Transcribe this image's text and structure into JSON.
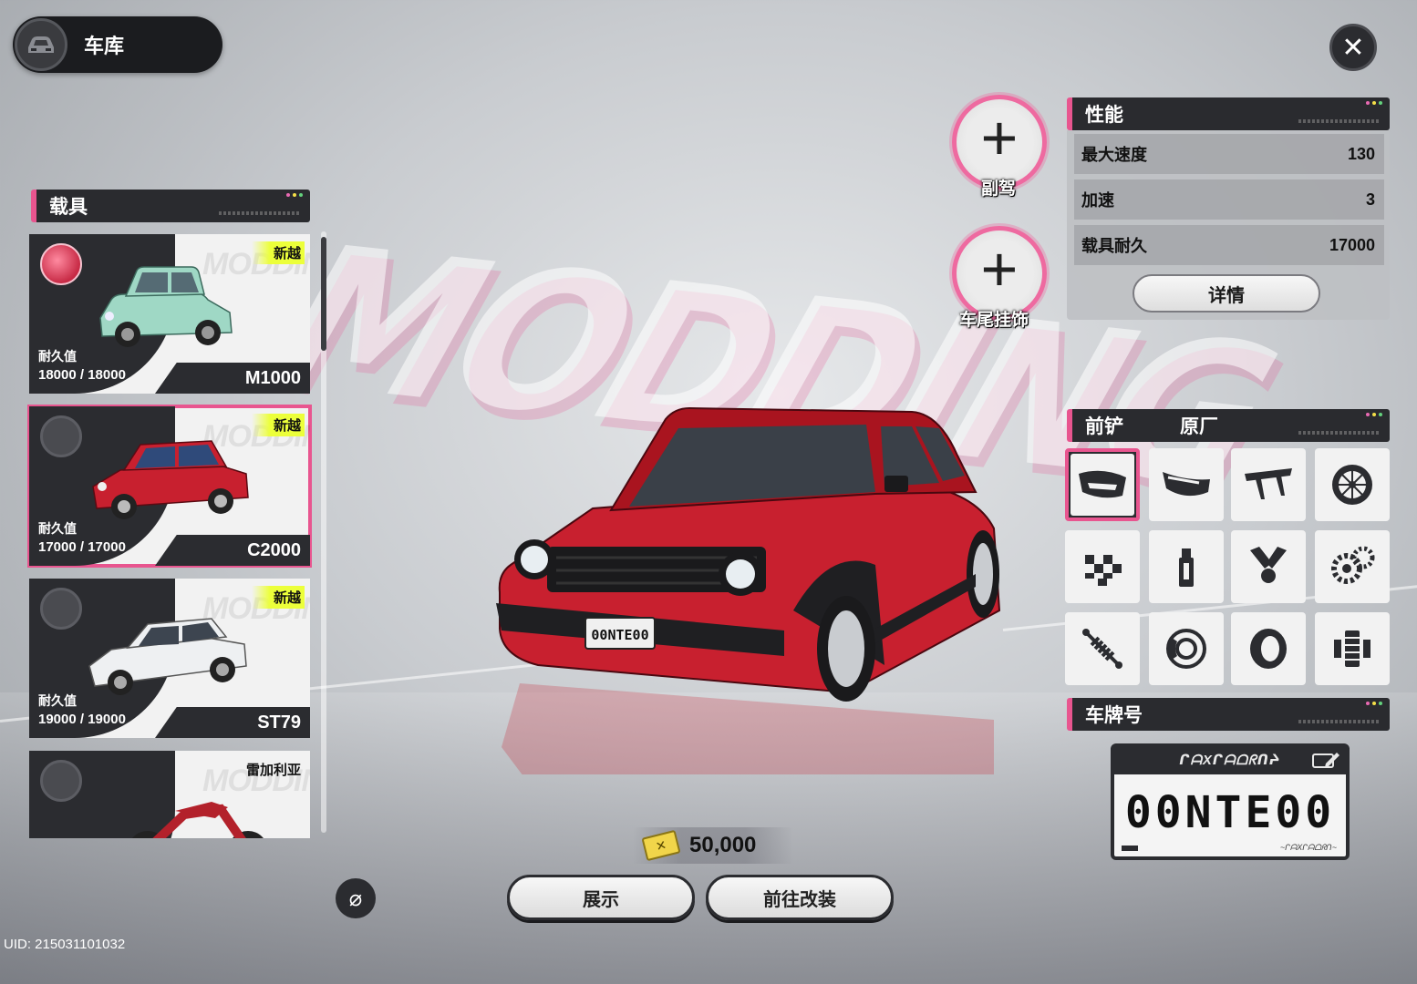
{
  "garage": {
    "title": "车库"
  },
  "background": {
    "word": "MODDING"
  },
  "vehicle_section": {
    "title": "载具"
  },
  "vehicles": [
    {
      "brand": "新越",
      "durability_label": "耐久值",
      "durability": "18000 / 18000",
      "model": "M1000",
      "color": "#9fd8c5"
    },
    {
      "brand": "新越",
      "durability_label": "耐久值",
      "durability": "17000 / 17000",
      "model": "C2000",
      "color": "#c8202f"
    },
    {
      "brand": "新越",
      "durability_label": "耐久值",
      "durability": "19000 / 19000",
      "model": "ST79",
      "color": "#eef0f2"
    },
    {
      "brand": "雷加利亚",
      "model": "",
      "color": "#b3212b"
    }
  ],
  "currency": {
    "amount": "50,000"
  },
  "buttons": {
    "display": "展示",
    "modify": "前往改装"
  },
  "uid": "UID: 215031101032",
  "add_slots": {
    "copilot": "副驾",
    "rear_ornament": "车尾挂饰"
  },
  "performance": {
    "title": "性能",
    "rows": [
      {
        "label": "最大速度",
        "value": "130"
      },
      {
        "label": "加速",
        "value": "3"
      },
      {
        "label": "载具耐久",
        "value": "17000"
      }
    ],
    "details_label": "详情"
  },
  "parts": {
    "category": "前铲",
    "current": "原厂",
    "icons": [
      "front-bumper-icon",
      "rear-bumper-icon",
      "spoiler-icon",
      "rim-icon",
      "livery-icon",
      "spray-paint-icon",
      "engine-piston-icon",
      "transmission-icon",
      "suspension-icon",
      "brake-icon",
      "tire-icon",
      "drivetrain-icon"
    ]
  },
  "plate": {
    "title": "车牌号",
    "number": "00NTE00",
    "brand_text": "ᒋᗩXᒋᗩᗝᖇᑎᔨ",
    "foot_text": "~ᒋᗩXᒋᗩᗝᖇᑎ~"
  },
  "colors": {
    "accent": "#e8558f",
    "panel": "#2b2c30",
    "selected_car": "#c8202f"
  }
}
